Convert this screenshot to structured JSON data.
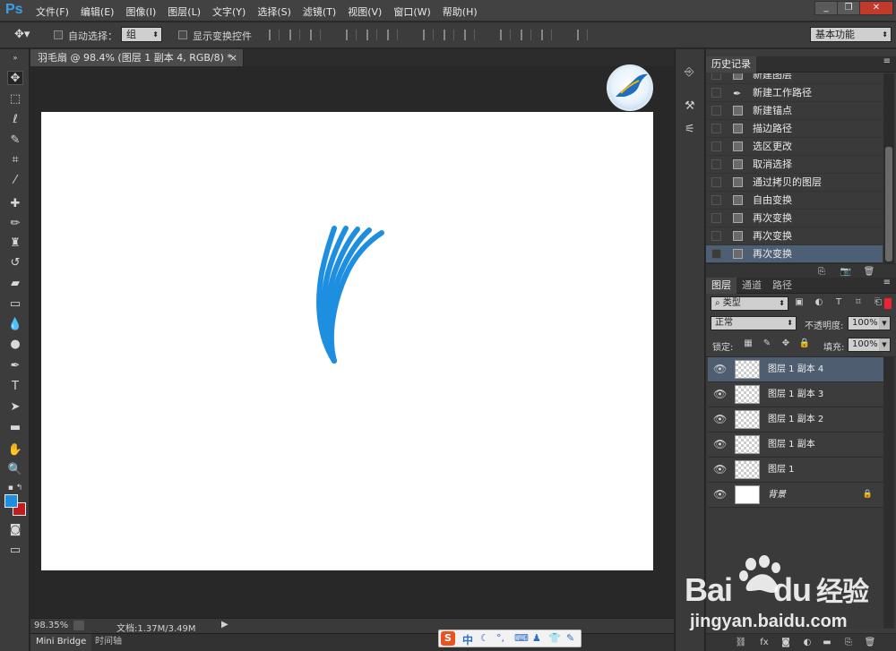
{
  "app": {
    "logo": "Ps"
  },
  "menu": [
    "文件(F)",
    "编辑(E)",
    "图像(I)",
    "图层(L)",
    "文字(Y)",
    "选择(S)",
    "滤镜(T)",
    "视图(V)",
    "窗口(W)",
    "帮助(H)"
  ],
  "window_controls": {
    "minimize": "_",
    "restore": "❐",
    "close": "✕"
  },
  "options": {
    "auto_select_label": "自动选择：",
    "auto_select_value": "组",
    "show_transform_label": "显示变换控件",
    "workspace": "基本功能"
  },
  "document": {
    "tab_title": "羽毛扇 @ 98.4% (图层 1 副本 4, RGB/8) *",
    "close": "×"
  },
  "status": {
    "zoom": "98.35%",
    "doc_info": "文档:1.37M/3.49M"
  },
  "bottom_tabs": [
    "Mini Bridge",
    "时间轴"
  ],
  "history": {
    "tab": "历史记录",
    "items": [
      {
        "label": "新建图层",
        "icon": "history-state-icon"
      },
      {
        "label": "新建工作路径",
        "icon": "pen-icon"
      },
      {
        "label": "新建锚点",
        "icon": "history-state-icon"
      },
      {
        "label": "描边路径",
        "icon": "history-state-icon"
      },
      {
        "label": "选区更改",
        "icon": "history-state-icon"
      },
      {
        "label": "取消选择",
        "icon": "history-state-icon"
      },
      {
        "label": "通过拷贝的图层",
        "icon": "history-state-icon"
      },
      {
        "label": "自由变换",
        "icon": "history-state-icon"
      },
      {
        "label": "再次变换",
        "icon": "history-state-icon"
      },
      {
        "label": "再次变换",
        "icon": "history-state-icon"
      },
      {
        "label": "再次变换",
        "icon": "history-state-icon"
      }
    ]
  },
  "layers_panel": {
    "tabs": [
      "图层",
      "通道",
      "路径"
    ],
    "filter_kind": "类型",
    "blend_mode": "正常",
    "opacity_label": "不透明度:",
    "opacity_value": "100%",
    "lock_label": "锁定:",
    "fill_label": "填充:",
    "fill_value": "100%",
    "layers": [
      {
        "name": "图层 1 副本 4",
        "selected": true
      },
      {
        "name": "图层 1 副本 3",
        "selected": false
      },
      {
        "name": "图层 1 副本 2",
        "selected": false
      },
      {
        "name": "图层 1 副本",
        "selected": false
      },
      {
        "name": "图层 1",
        "selected": false
      },
      {
        "name": "背景",
        "selected": false,
        "locked": true
      }
    ]
  },
  "colors": {
    "foreground": "#1e8fe0",
    "background": "#c21d1d",
    "stroke": "#1e8fe0"
  },
  "watermark": {
    "brand": "Bai",
    "brand2": "du",
    "brand_cn": "经验",
    "url": "jingyan.baidu.com"
  }
}
